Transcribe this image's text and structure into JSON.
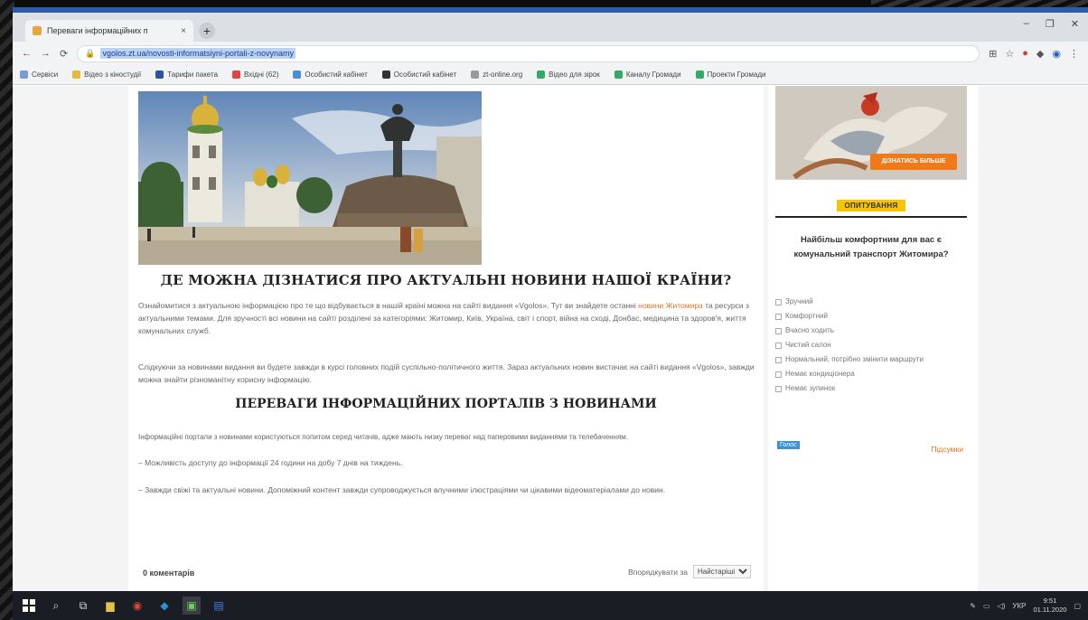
{
  "browser": {
    "tab_title": "Переваги інформаційних п",
    "tab_close": "×",
    "new_tab": "+",
    "url": "vgolos.zt.ua/novosti-informatsiyni-portali-z-novynamy"
  },
  "bookmarks": [
    "Сервіси",
    "Відео з кіностудії",
    "Тарифи пакета",
    "Вхідні (62)",
    "Особистий кабінет",
    "Особистий кабінет",
    "zt-online.org",
    "Відео для зірок",
    "Каналу Громади",
    "Проекти Громади"
  ],
  "article": {
    "heading1": "ДЕ МОЖНА ДІЗНАТИСЯ ПРО АКТУАЛЬНІ НОВИНИ НАШОЇ КРАЇНИ?",
    "p1_before": "Ознайомитися з актуальною інформацією про те що відбувається в нашій країні можна на сайті видання «Vgolos». Тут ви знайдете останні ",
    "p1_link": "новини Житомира",
    "p1_after": " та ресурси з актуальними темами. Для зручності всі новини на сайті розділені за категоріями: Житомир, Київ, Україна, світ і спорт, війна на сході, Донбас, медицина та здоров'я, життя комунальних служб.",
    "p2": "Слідкуючи за новинами видання ви будете завжди в курсі головних подій суспільно-політичного життя. Зараз актуальних новин вистачає на сайті видання «Vgolos», завжди можна знайти різноманітну корисну інформацію.",
    "heading2": "ПЕРЕВАГИ ІНФОРМАЦІЙНИХ ПОРТАЛІВ З НОВИНАМИ",
    "p3": "Інформаційні портали з новинами користуються попитом серед читачів, адже мають низку переваг над паперовими виданнями та телебаченням.",
    "p4": "– Можливість доступу до інформації 24 години на добу 7 днів на тиждень.",
    "p5": "– Завжди свіжі та актуальні новини. Допоміжний контент завжди супроводжується влучними ілюстраціями чи цікавими відеоматеріалами до новин.",
    "comments": "0 коментарів",
    "sort_label": "Впорядкувати за",
    "sort_value": "Найстаріші"
  },
  "sidebar": {
    "banner_button": "ДІЗНАТИСЬ БІЛЬШЕ",
    "poll_title": "ОПИТУВАННЯ",
    "poll_question": "Найбільш комфортним для вас є комунальний транспорт Житомира?",
    "options": [
      "Зручний",
      "Комфортний",
      "Вчасно ходить",
      "Чистий салон",
      "Нормальний, потрібно змінити маршрути",
      "Немає кондиціонера",
      "Немає зупинок"
    ],
    "vote_button": "Голос",
    "results_link": "Підсумки"
  },
  "taskbar": {
    "clock_time": "9:51",
    "clock_date": "01.11.2020",
    "lang": "УКР"
  }
}
